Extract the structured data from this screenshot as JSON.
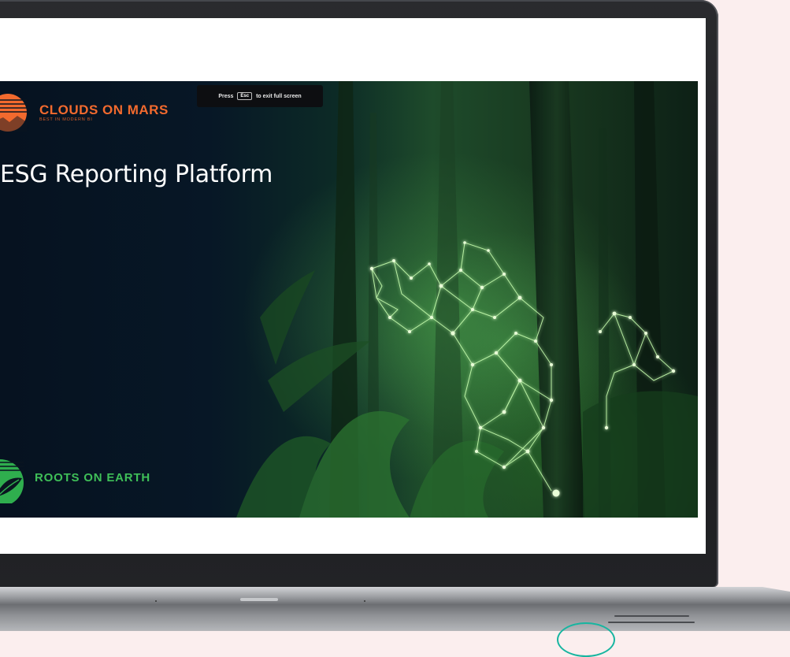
{
  "fullscreen_tip": {
    "prefix": "Press",
    "key": "Esc",
    "suffix": "to exit full screen"
  },
  "slide": {
    "brand_top": {
      "name": "CLOUDS ON MARS",
      "tagline": "BEST IN MODERN BI",
      "logo_icon": "clouds-on-mars-logo-icon",
      "color": "#f26a2e"
    },
    "title": "ESG Reporting Platform",
    "brand_bottom": {
      "name": "ROOTS ON EARTH",
      "logo_icon": "roots-on-earth-logo-icon",
      "color": "#3fbf58"
    },
    "background_image": "forest-network-image"
  },
  "colors": {
    "page_background": "#fbeeee",
    "screen_bezel": "#1b1c1f",
    "accent_ring": "#17b5a0"
  }
}
